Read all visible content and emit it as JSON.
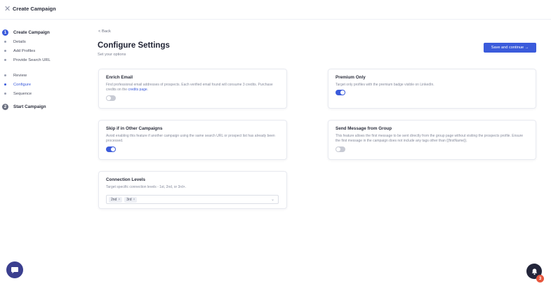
{
  "header": {
    "close_icon": "close-icon",
    "title": "Create Campaign"
  },
  "sidebar": {
    "steps": [
      {
        "number": "1",
        "label": "Create Campaign"
      },
      {
        "number": "2",
        "label": "Start Campaign"
      }
    ],
    "items": [
      {
        "label": "Details"
      },
      {
        "label": "Add Profiles"
      },
      {
        "label": "Provide Search URL"
      },
      {
        "label": "Review"
      },
      {
        "label": "Configure"
      },
      {
        "label": "Sequence"
      }
    ],
    "current_item": "Configure"
  },
  "main": {
    "back_label": "< Back",
    "title": "Configure Settings",
    "subtitle": "Set your options",
    "save_button_label": "Save and continue →"
  },
  "cards": {
    "enrich": {
      "title": "Enrich Email",
      "desc": "Find professional email addresses of prospects. Each verified email found will consume 3 credits. Purchase credits on the",
      "link": "credits page",
      "desc_end": ".",
      "enabled": false
    },
    "premium": {
      "title": "Premium Only",
      "desc": "Target only profiles with the premium badge visible on LinkedIn.",
      "enabled": true
    },
    "skip": {
      "title": "Skip if in Other Campaigns",
      "desc": "Avoid enabling this feature if another campaign using the same search URL or prospect list has already been processed.",
      "enabled": true
    },
    "group": {
      "title": "Send Message from Group",
      "desc": "This feature allows the first message to be sent directly from the group page without visiting the prospects profile. Ensure the first message in the campaign does not include any tags other than {{firstName}}.",
      "enabled": false
    },
    "connection": {
      "title": "Connection Levels",
      "desc": "Target specific connection levels - 1st, 2nd, or 3rd+.",
      "selected": [
        "2nd",
        "3rd"
      ]
    }
  },
  "floating": {
    "chat_icon": "chat-icon",
    "notification_icon": "bell-icon",
    "notification_count": "3"
  },
  "colors": {
    "accent": "#3b5bdb",
    "badge": "#e8573e"
  }
}
